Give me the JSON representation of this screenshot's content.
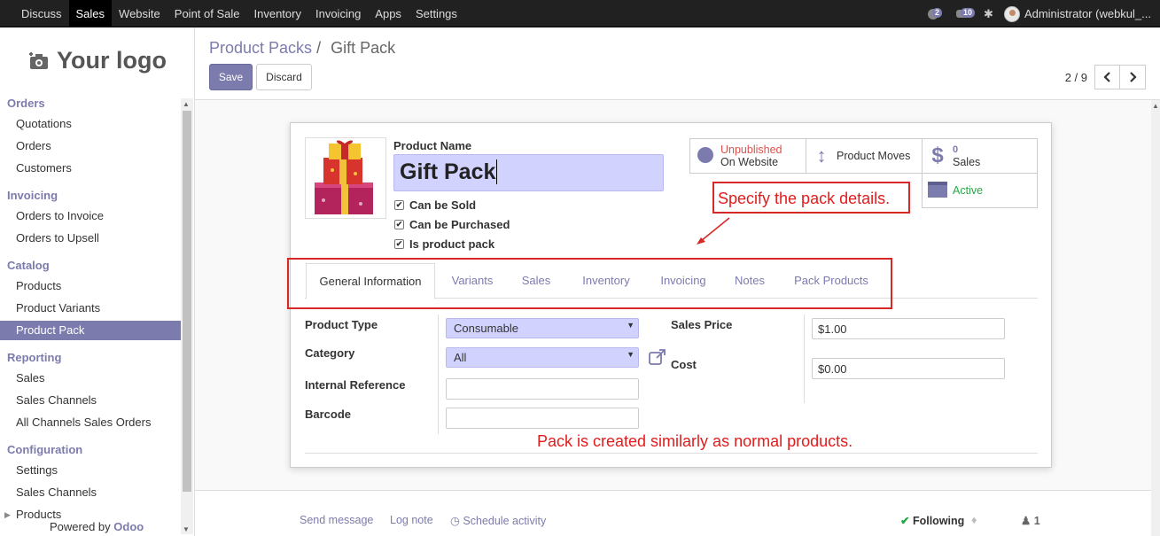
{
  "topnav": {
    "items": [
      "Discuss",
      "Sales",
      "Website",
      "Point of Sale",
      "Inventory",
      "Invoicing",
      "Apps",
      "Settings"
    ],
    "active": "Sales",
    "messages_count": "2",
    "activity_count": "10",
    "user": "Administrator (webkul_..."
  },
  "sidebar": {
    "logo": "Your logo",
    "sections": [
      {
        "title": "Orders",
        "items": [
          "Quotations",
          "Orders",
          "Customers"
        ]
      },
      {
        "title": "Invoicing",
        "items": [
          "Orders to Invoice",
          "Orders to Upsell"
        ]
      },
      {
        "title": "Catalog",
        "items": [
          "Products",
          "Product Variants",
          "Product Pack"
        ]
      },
      {
        "title": "Reporting",
        "items": [
          "Sales",
          "Sales Channels",
          "All Channels Sales Orders"
        ]
      },
      {
        "title": "Configuration",
        "items": [
          "Settings",
          "Sales Channels",
          "Products"
        ]
      }
    ],
    "active_item": "Product Pack",
    "powered_by": "Powered by",
    "powered_brand": "Odoo"
  },
  "control_panel": {
    "breadcrumb_parent": "Product Packs",
    "breadcrumb_sep": "/",
    "breadcrumb_current": "Gift Pack",
    "save_label": "Save",
    "discard_label": "Discard",
    "pager_value": "2 / 9",
    "pager_prev": "<",
    "pager_next": ">"
  },
  "form": {
    "product_name_label": "Product Name",
    "product_name": "Gift Pack",
    "checkboxes": [
      {
        "label": "Can be Sold",
        "checked": true
      },
      {
        "label": "Can be Purchased",
        "checked": true
      },
      {
        "label": "Is product pack",
        "checked": true
      }
    ],
    "smart_buttons": {
      "website_status": "Unpublished",
      "website_sub": "On Website",
      "moves_label": "Product Moves",
      "sales_count": "0",
      "sales_label": "Sales",
      "active_label": "Active"
    },
    "tabs": [
      "General Information",
      "Variants",
      "Sales",
      "Inventory",
      "Invoicing",
      "Notes",
      "Pack Products"
    ],
    "active_tab": "General Information",
    "fields": {
      "product_type_label": "Product Type",
      "product_type": "Consumable",
      "category_label": "Category",
      "category": "All",
      "internal_ref_label": "Internal Reference",
      "internal_ref": "",
      "barcode_label": "Barcode",
      "barcode": "",
      "sales_price_label": "Sales Price",
      "sales_price": "$1.00",
      "cost_label": "Cost",
      "cost": "$0.00"
    }
  },
  "annotations": {
    "top": "Specify the pack details.",
    "bottom": "Pack is created similarly as normal products."
  },
  "chatter": {
    "send_message": "Send message",
    "log_note": "Log note",
    "schedule": "Schedule activity",
    "following": "Following",
    "followers": "1"
  },
  "colors": {
    "accent": "#7c7bad",
    "annotation": "#e31b1b",
    "topbar": "#212121",
    "active_green": "#28a745"
  }
}
